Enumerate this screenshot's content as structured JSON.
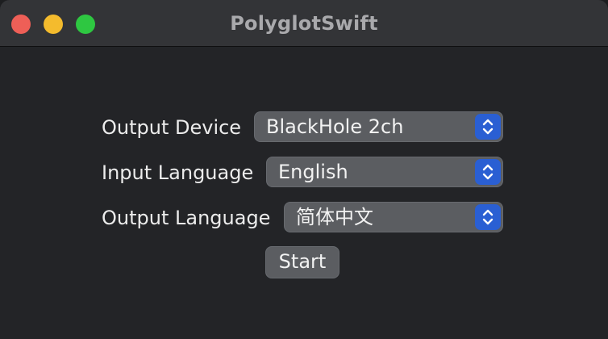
{
  "window": {
    "title": "PolyglotSwift"
  },
  "form": {
    "output_device": {
      "label": "Output Device",
      "value": "BlackHole 2ch"
    },
    "input_language": {
      "label": "Input Language",
      "value": "English"
    },
    "output_language": {
      "label": "Output Language",
      "value": "简体中文"
    },
    "start_label": "Start"
  },
  "colors": {
    "accent": "#2a5fd3",
    "close": "#ee5f57",
    "minimize": "#f4bb2d",
    "zoom": "#2ec741"
  },
  "icons": {
    "stepper": "chevron-up-down-icon"
  }
}
